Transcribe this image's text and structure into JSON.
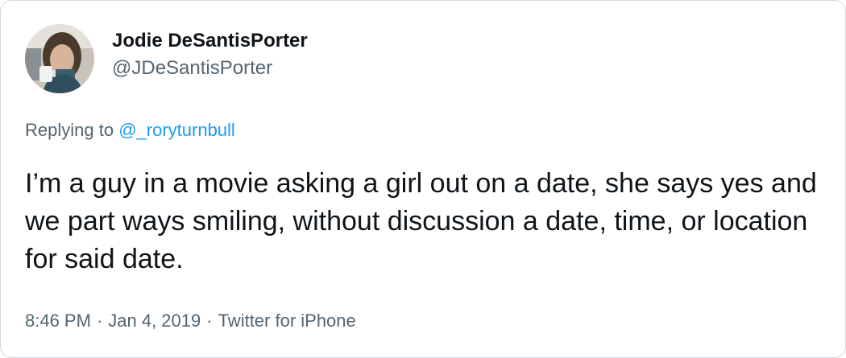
{
  "tweet": {
    "author": {
      "display_name": "Jodie DeSantisPorter",
      "handle": "@JDeSantisPorter"
    },
    "reply": {
      "prefix": "Replying to",
      "mention": "@_roryturnbull"
    },
    "text": "I’m a guy in a movie asking a girl out on a date, she says yes and we part ways smiling, without discussion a date, time, or location for said date.",
    "meta": {
      "time": "8:46 PM",
      "separator": "·",
      "date": "Jan 4, 2019",
      "source": "Twitter for iPhone"
    }
  },
  "colors": {
    "text_primary": "#0f1419",
    "text_secondary": "#536471",
    "link": "#1d9bf0",
    "border": "#cfd9de"
  },
  "icons": {
    "avatar": "user-photo-avatar"
  }
}
